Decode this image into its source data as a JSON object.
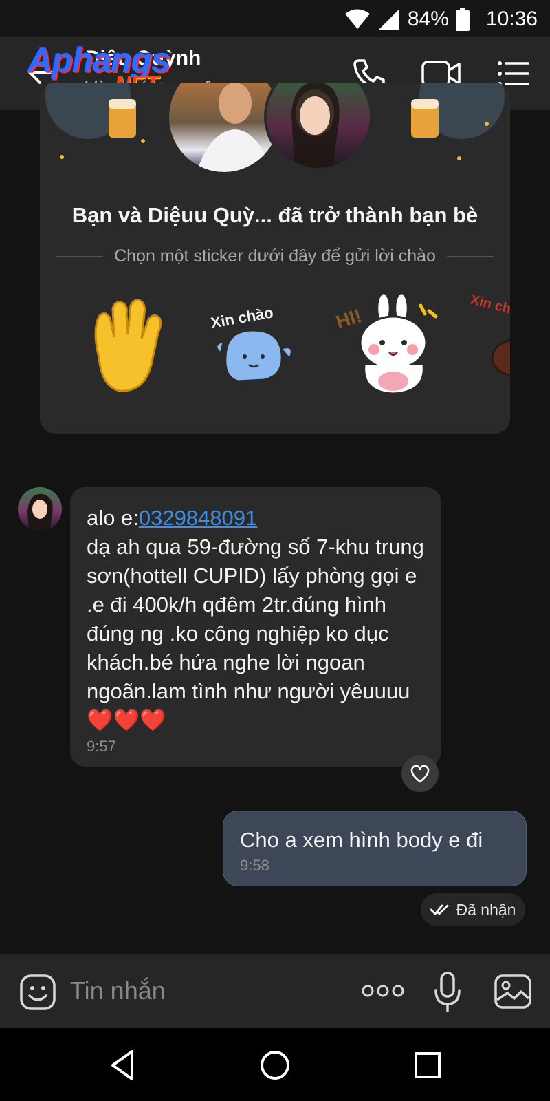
{
  "status_bar": {
    "battery": "84%",
    "time": "10:36"
  },
  "header": {
    "contact_name": "Diệu Quỳnh",
    "contact_status": "Vừa mới truy cập",
    "watermark": {
      "main": "Aphangs",
      "sub": ".NET"
    },
    "icons": [
      "back-arrow-icon",
      "phone-icon",
      "video-call-icon",
      "menu-list-icon"
    ]
  },
  "friend_card": {
    "title": "Bạn và Diệuu Quỳ...  đã trở thành bạn bè",
    "subtitle": "Chọn một sticker dưới đây để gửi lời chào",
    "stickers": [
      {
        "name": "waving-hand-sticker",
        "label": ""
      },
      {
        "name": "xin-chao-sticker",
        "label": "Xin chào"
      },
      {
        "name": "hi-bunny-sticker",
        "label": "HI!"
      },
      {
        "name": "xin-chao-partial-sticker",
        "label": "Xin chà"
      }
    ]
  },
  "messages": [
    {
      "direction": "incoming",
      "prefix": "alo e:",
      "phone": "0329848091",
      "body": "dạ ah qua 59-đường số 7-khu trung sơn(hottell CUPID) lấy phòng gọi e .e đi 400k/h qđêm 2tr.đúng hình đúng ng .ko công nghiệp ko dục khách.bé hứa nghe lời ngoan ngoãn.lam tình như người yêuuuu",
      "hearts": "❤️❤️❤️",
      "time": "9:57"
    },
    {
      "direction": "outgoing",
      "body": "Cho a xem hình body e đi",
      "time": "9:58",
      "status": "Đã nhận"
    }
  ],
  "composer": {
    "placeholder": "Tin nhắn",
    "value": ""
  },
  "colors": {
    "background": "#131313",
    "header": "#262626",
    "bubble_in": "#2a2a2a",
    "bubble_out": "#3d4757",
    "link": "#3b8fe8",
    "heart": "#e0242c"
  }
}
